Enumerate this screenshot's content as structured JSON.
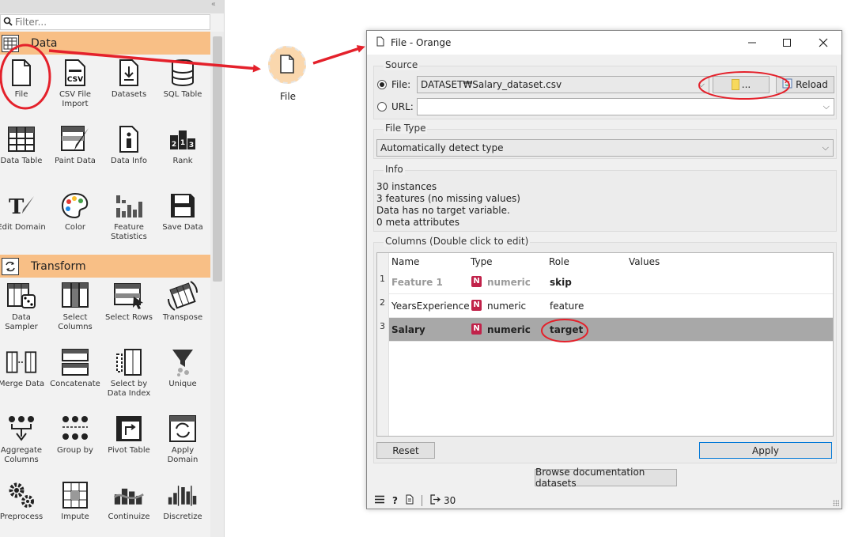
{
  "panel": {
    "filter_placeholder": "Filter...",
    "collapse_glyph": "«",
    "categories": [
      {
        "label": "Data"
      },
      {
        "label": "Transform"
      }
    ],
    "data_widgets": [
      {
        "label": "File",
        "icon": "file-icon"
      },
      {
        "label": "CSV File Import",
        "icon": "csv-icon"
      },
      {
        "label": "Datasets",
        "icon": "datasets-icon"
      },
      {
        "label": "SQL Table",
        "icon": "database-icon"
      },
      {
        "label": "Data Table",
        "icon": "table-icon"
      },
      {
        "label": "Paint Data",
        "icon": "paint-icon"
      },
      {
        "label": "Data Info",
        "icon": "info-icon"
      },
      {
        "label": "Rank",
        "icon": "rank-icon"
      },
      {
        "label": "Edit Domain",
        "icon": "edit-domain-icon"
      },
      {
        "label": "Color",
        "icon": "palette-icon"
      },
      {
        "label": "Feature Statistics",
        "icon": "stats-icon"
      },
      {
        "label": "Save Data",
        "icon": "floppy-icon"
      }
    ],
    "transform_widgets": [
      {
        "label": "Data Sampler",
        "icon": "sampler-icon"
      },
      {
        "label": "Select Columns",
        "icon": "select-columns-icon"
      },
      {
        "label": "Select Rows",
        "icon": "select-rows-icon"
      },
      {
        "label": "Transpose",
        "icon": "transpose-icon"
      },
      {
        "label": "Merge Data",
        "icon": "merge-icon"
      },
      {
        "label": "Concatenate",
        "icon": "concatenate-icon"
      },
      {
        "label": "Select by Data Index",
        "icon": "select-index-icon"
      },
      {
        "label": "Unique",
        "icon": "funnel-icon"
      },
      {
        "label": "Aggregate Columns",
        "icon": "aggregate-icon"
      },
      {
        "label": "Group by",
        "icon": "group-icon"
      },
      {
        "label": "Pivot Table",
        "icon": "pivot-icon"
      },
      {
        "label": "Apply Domain",
        "icon": "apply-domain-icon"
      },
      {
        "label": "Preprocess",
        "icon": "gears-icon"
      },
      {
        "label": "Impute",
        "icon": "impute-icon"
      },
      {
        "label": "Continuize",
        "icon": "continuize-icon"
      },
      {
        "label": "Discretize",
        "icon": "discretize-icon"
      }
    ]
  },
  "canvas": {
    "node_label": "File"
  },
  "dialog": {
    "title": "File - Orange",
    "source": {
      "title": "Source",
      "file_label": "File:",
      "file_value": "DATASET₩Salary_dataset.csv",
      "browse_label": "...",
      "reload_label": "Reload",
      "url_label": "URL:",
      "url_value": ""
    },
    "file_type": {
      "title": "File Type",
      "value": "Automatically detect type"
    },
    "info": {
      "title": "Info",
      "lines": [
        "30 instances",
        "3 features (no missing values)",
        "Data has no target variable.",
        "0 meta attributes"
      ]
    },
    "columns": {
      "title": "Columns (Double click to edit)",
      "headers": [
        "Name",
        "Type",
        "Role",
        "Values"
      ],
      "rows": [
        {
          "num": "1",
          "name": "Feature 1",
          "badge": "N",
          "type": "numeric",
          "role": "skip",
          "values": ""
        },
        {
          "num": "2",
          "name": "YearsExperience",
          "badge": "N",
          "type": "numeric",
          "role": "feature",
          "values": ""
        },
        {
          "num": "3",
          "name": "Salary",
          "badge": "N",
          "type": "numeric",
          "role": "target",
          "values": ""
        }
      ]
    },
    "reset_label": "Reset",
    "apply_label": "Apply",
    "browse_docs_label": "Browse documentation datasets",
    "status_count": "30"
  },
  "colors": {
    "category_bg": "#f8bf86",
    "node_bg": "#fad7ad",
    "annotation_red": "#e4212b",
    "numeric_badge": "#c1224a",
    "selected_row": "#a8a8a8"
  }
}
